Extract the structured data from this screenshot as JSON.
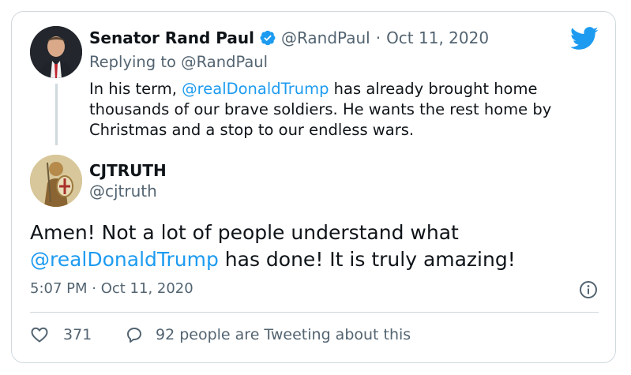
{
  "parent_tweet": {
    "display_name": "Senator Rand Paul",
    "handle": "@RandPaul",
    "separator": "·",
    "date": "Oct 11, 2020",
    "replying_prefix": "Replying to",
    "replying_to": "@RandPaul",
    "text_before_mention": "In his term, ",
    "mention": "@realDonaldTrump",
    "text_after_mention": " has already brought home thousands of our brave soldiers. He wants the rest home by Christmas and a stop to our endless wars."
  },
  "reply_tweet": {
    "display_name": "CJTRUTH",
    "handle": "@cjtruth",
    "text_before_mention": "Amen!  Not a lot of people understand what ",
    "mention": "@realDonaldTrump",
    "text_after_mention": " has done!  It is truly amazing!",
    "timestamp": "5:07 PM · Oct 11, 2020"
  },
  "footer": {
    "like_count": "371",
    "tweeting_text": "92 people are Tweeting about this"
  },
  "icons": {
    "brand": "twitter-bird-icon",
    "verified": "verified-badge-icon",
    "info": "info-icon",
    "like": "heart-icon",
    "reply": "reply-bubble-icon"
  },
  "colors": {
    "accent": "#1d9bf0",
    "text": "#0f1419",
    "muted": "#536471",
    "border": "#cfd9de"
  }
}
